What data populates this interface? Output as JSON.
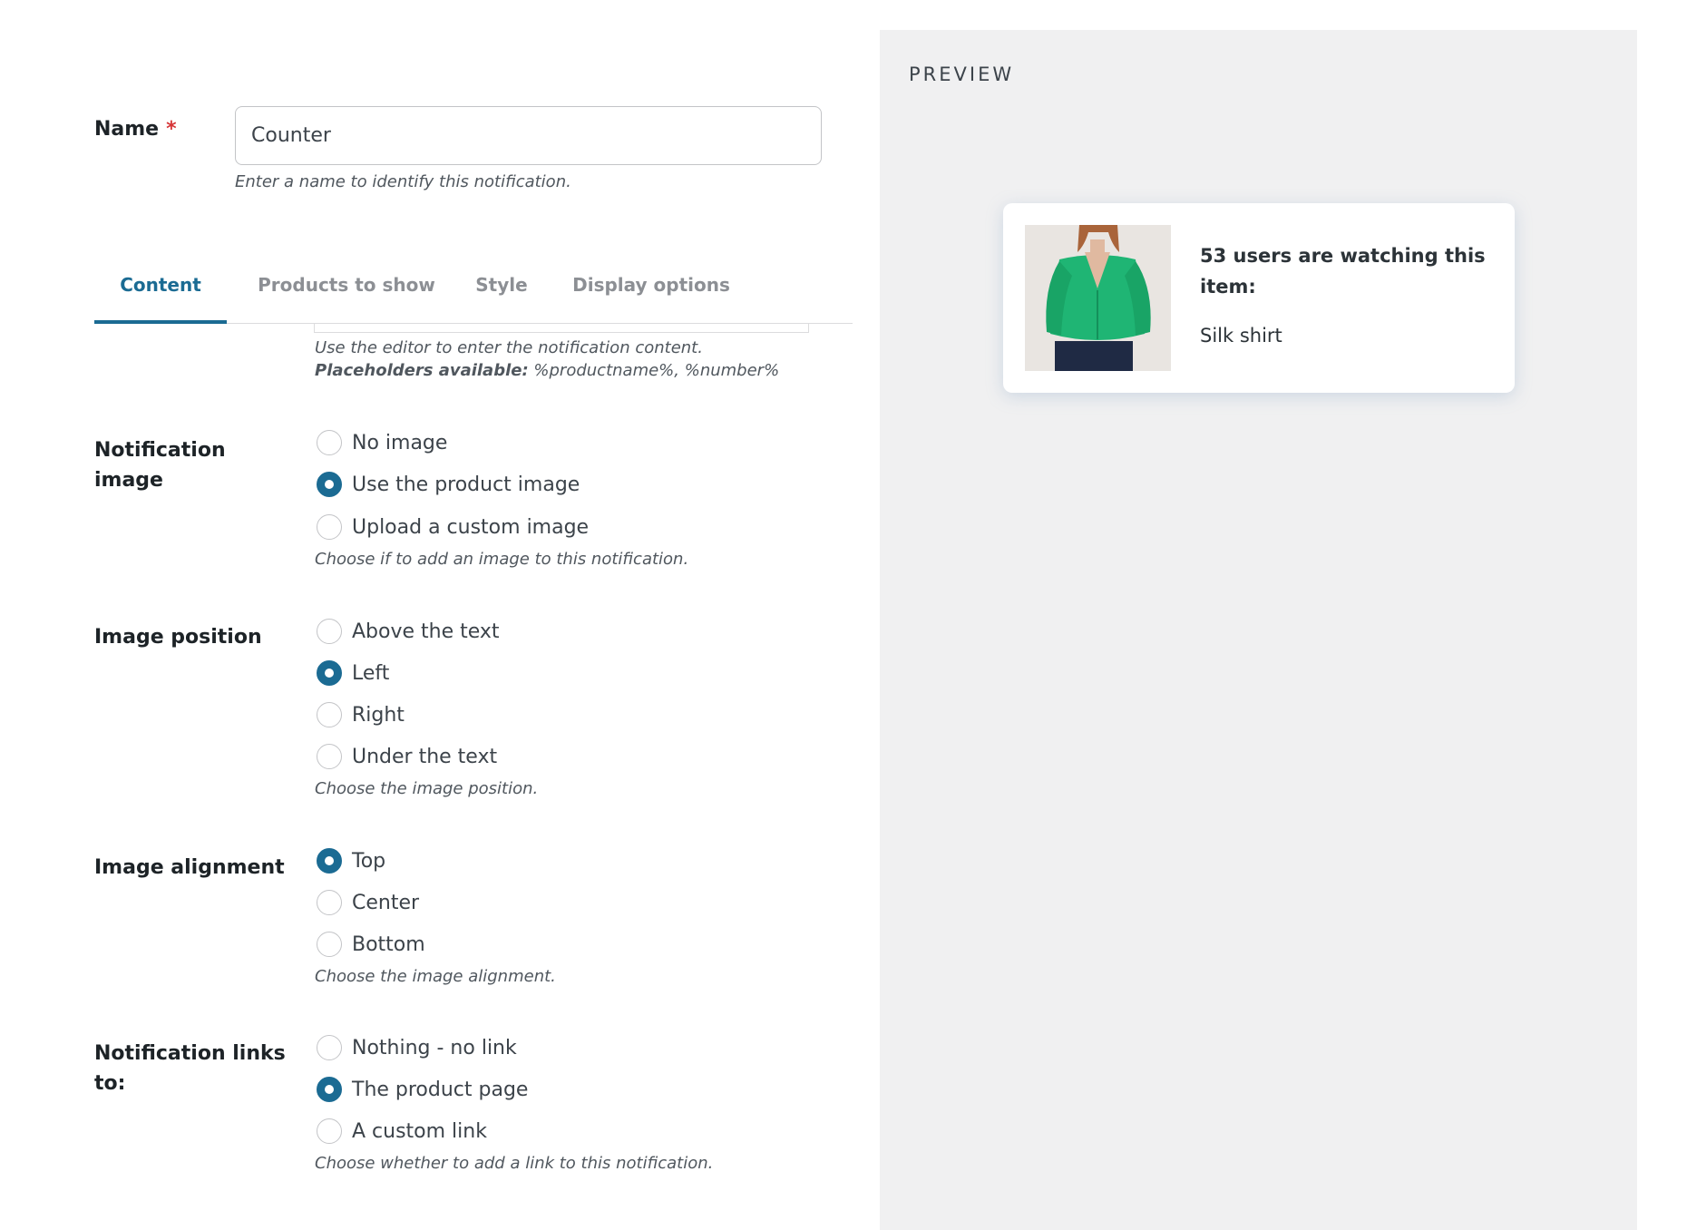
{
  "form": {
    "name_label": "Name",
    "required_mark": "*",
    "name_value": "Counter",
    "name_help": "Enter a name to identify this notification."
  },
  "tabs": [
    {
      "label": "Content",
      "active": true
    },
    {
      "label": "Products to show",
      "active": false
    },
    {
      "label": "Style",
      "active": false
    },
    {
      "label": "Display options",
      "active": false
    }
  ],
  "content": {
    "editor_help": "Use the editor to enter the notification content.",
    "placeholders_label": "Placeholders available:",
    "placeholders_value": "%productname%, %number%"
  },
  "notification_image": {
    "label_line1": "Notification",
    "label_line2": "image",
    "options": [
      "No image",
      "Use the product image",
      "Upload a custom image"
    ],
    "selected": "Use the product image",
    "help": "Choose if to add an image to this notification."
  },
  "image_position": {
    "label": "Image position",
    "options": [
      "Above the text",
      "Left",
      "Right",
      "Under the text"
    ],
    "selected": "Left",
    "help": "Choose the image position."
  },
  "image_alignment": {
    "label": "Image alignment",
    "options": [
      "Top",
      "Center",
      "Bottom"
    ],
    "selected": "Top",
    "help": "Choose the image alignment."
  },
  "notification_links": {
    "label_line1": "Notification links",
    "label_line2": "to:",
    "options": [
      "Nothing - no link",
      "The product page",
      "A custom link"
    ],
    "selected": "The product page",
    "help": "Choose whether to add a link to this notification."
  },
  "preview": {
    "title": "PREVIEW",
    "message": "53 users are watching this item:",
    "product_name": "Silk shirt"
  },
  "colors": {
    "accent": "#1b6b93",
    "required": "#d63638",
    "preview_bg": "#f0f0f1",
    "shirt": "#1fb574"
  }
}
